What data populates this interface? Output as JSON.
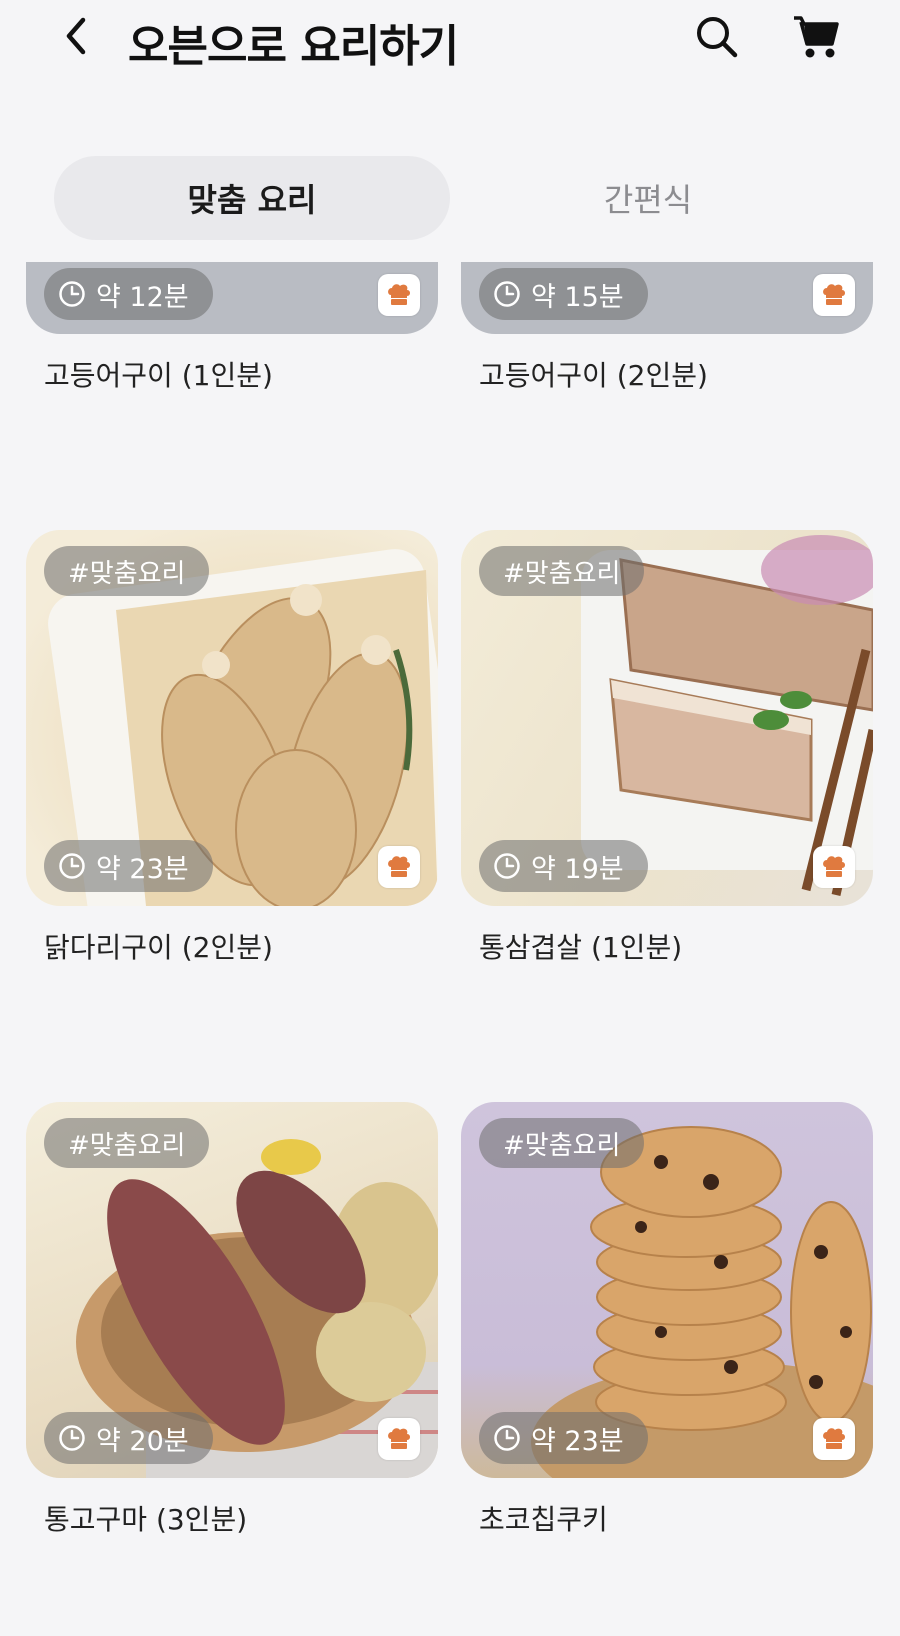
{
  "header": {
    "title": "오븐으로 요리하기",
    "back_icon": "chevron-left-icon",
    "search_icon": "search-icon",
    "cart_icon": "cart-icon"
  },
  "tabs": [
    {
      "label": "맞춤 요리",
      "active": true
    },
    {
      "label": "간편식",
      "active": false
    }
  ],
  "recipes": [
    {
      "name": "고등어구이 (1인분)",
      "time": "약 12분",
      "tag": ""
    },
    {
      "name": "고등어구이 (2인분)",
      "time": "약 15분",
      "tag": ""
    },
    {
      "name": "닭다리구이 (2인분)",
      "time": "약 23분",
      "tag": "#맞춤요리"
    },
    {
      "name": "통삼겹살 (1인분)",
      "time": "약 19분",
      "tag": "#맞춤요리"
    },
    {
      "name": "통고구마 (3인분)",
      "time": "약 20분",
      "tag": "#맞춤요리"
    },
    {
      "name": "초코칩쿠키",
      "time": "약 23분",
      "tag": "#맞춤요리"
    }
  ],
  "colors": {
    "background": "#f5f5f7",
    "tab_active_bg": "#e9e9ec",
    "chef_icon": "#e07a3f"
  }
}
